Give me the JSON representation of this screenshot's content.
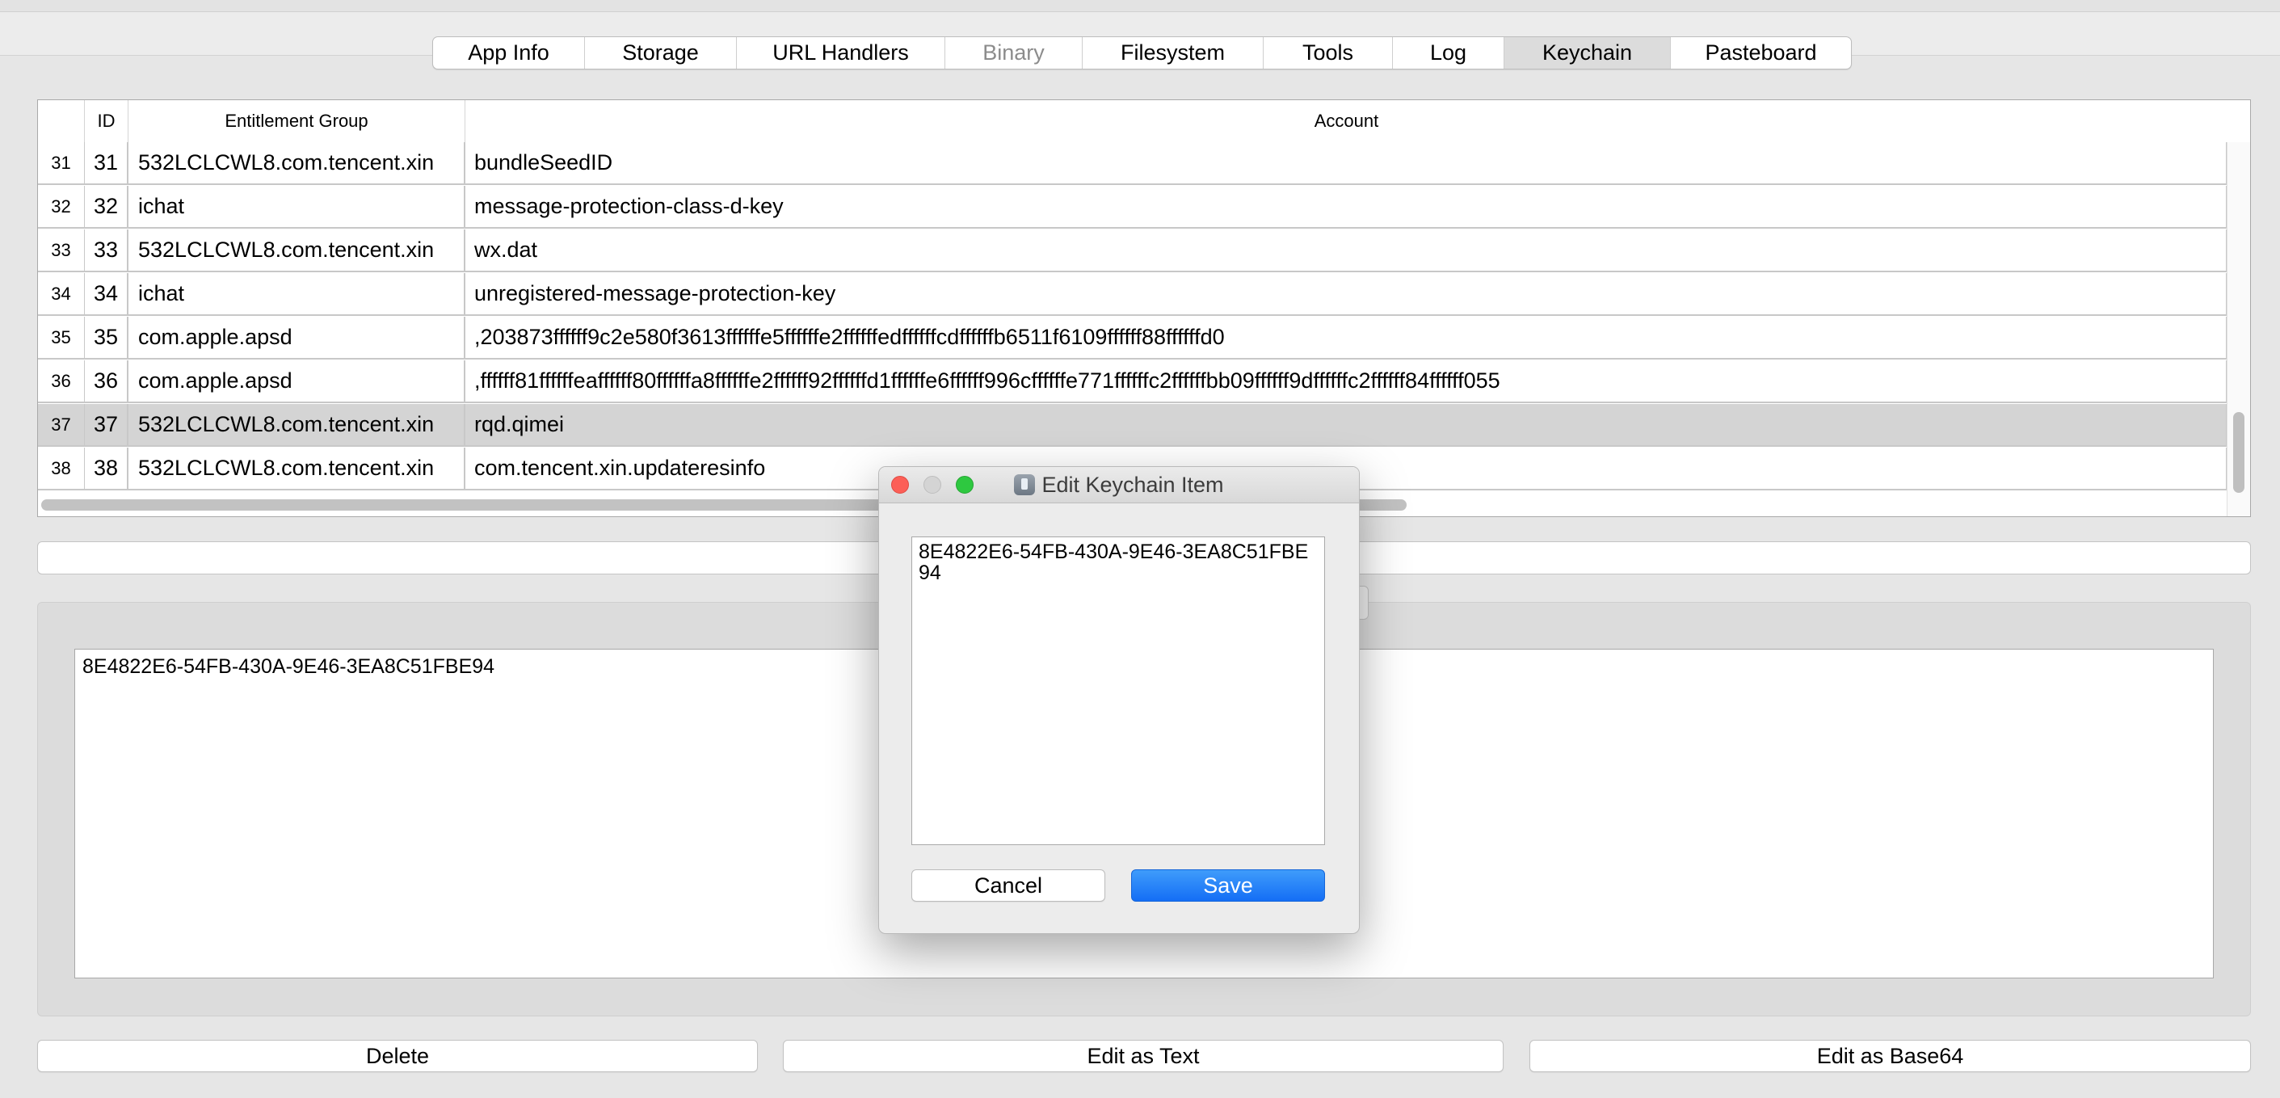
{
  "tabs": [
    {
      "label": "App Info",
      "state": "normal"
    },
    {
      "label": "Storage",
      "state": "normal"
    },
    {
      "label": "URL Handlers",
      "state": "normal"
    },
    {
      "label": "Binary",
      "state": "disabled"
    },
    {
      "label": "Filesystem",
      "state": "normal"
    },
    {
      "label": "Tools",
      "state": "normal"
    },
    {
      "label": "Log",
      "state": "normal"
    },
    {
      "label": "Keychain",
      "state": "active"
    },
    {
      "label": "Pasteboard",
      "state": "normal"
    }
  ],
  "table": {
    "headers": {
      "num": "",
      "id": "ID",
      "group": "Entitlement Group",
      "account": "Account"
    },
    "rows": [
      {
        "num": "31",
        "id": "31",
        "group": "532LCLCWL8.com.tencent.xin",
        "account": "bundleSeedID",
        "selected": false
      },
      {
        "num": "32",
        "id": "32",
        "group": "ichat",
        "account": "message-protection-class-d-key",
        "selected": false
      },
      {
        "num": "33",
        "id": "33",
        "group": "532LCLCWL8.com.tencent.xin",
        "account": "wx.dat",
        "selected": false
      },
      {
        "num": "34",
        "id": "34",
        "group": "ichat",
        "account": "unregistered-message-protection-key",
        "selected": false
      },
      {
        "num": "35",
        "id": "35",
        "group": "com.apple.apsd",
        "account": ",203873ffffff9c2e580f3613ffffffe5ffffffe2ffffffedffffffcdffffffb6511f6109ffffff88ffffffd0",
        "selected": false
      },
      {
        "num": "36",
        "id": "36",
        "group": "com.apple.apsd",
        "account": ",ffffff81ffffffeaffffff80ffffffa8ffffffe2ffffff92ffffffd1ffffffe6ffffff996cffffffe771ffffffc2ffffffbb09ffffff9dffffffc2ffffff84ffffff055",
        "selected": false
      },
      {
        "num": "37",
        "id": "37",
        "group": "532LCLCWL8.com.tencent.xin",
        "account": "rqd.qimei",
        "selected": true
      },
      {
        "num": "38",
        "id": "38",
        "group": "532LCLCWL8.com.tencent.xin",
        "account": "com.tencent.xin.updateresinfo",
        "selected": false
      }
    ]
  },
  "filter_field": {
    "value": ""
  },
  "value_view": {
    "text": "8E4822E6-54FB-430A-9E46-3EA8C51FBE94"
  },
  "buttons": {
    "delete": "Delete",
    "edit_text": "Edit as Text",
    "edit_base64": "Edit as Base64"
  },
  "dialog": {
    "title": "Edit Keychain Item",
    "text_value": "8E4822E6-54FB-430A-9E46-3EA8C51FBE94",
    "cancel_label": "Cancel",
    "save_label": "Save"
  },
  "colors": {
    "accent": "#146ef5",
    "selected_row": "#d4d4d4",
    "close_light": "#fc5f57",
    "zoom_light": "#2ec840"
  }
}
